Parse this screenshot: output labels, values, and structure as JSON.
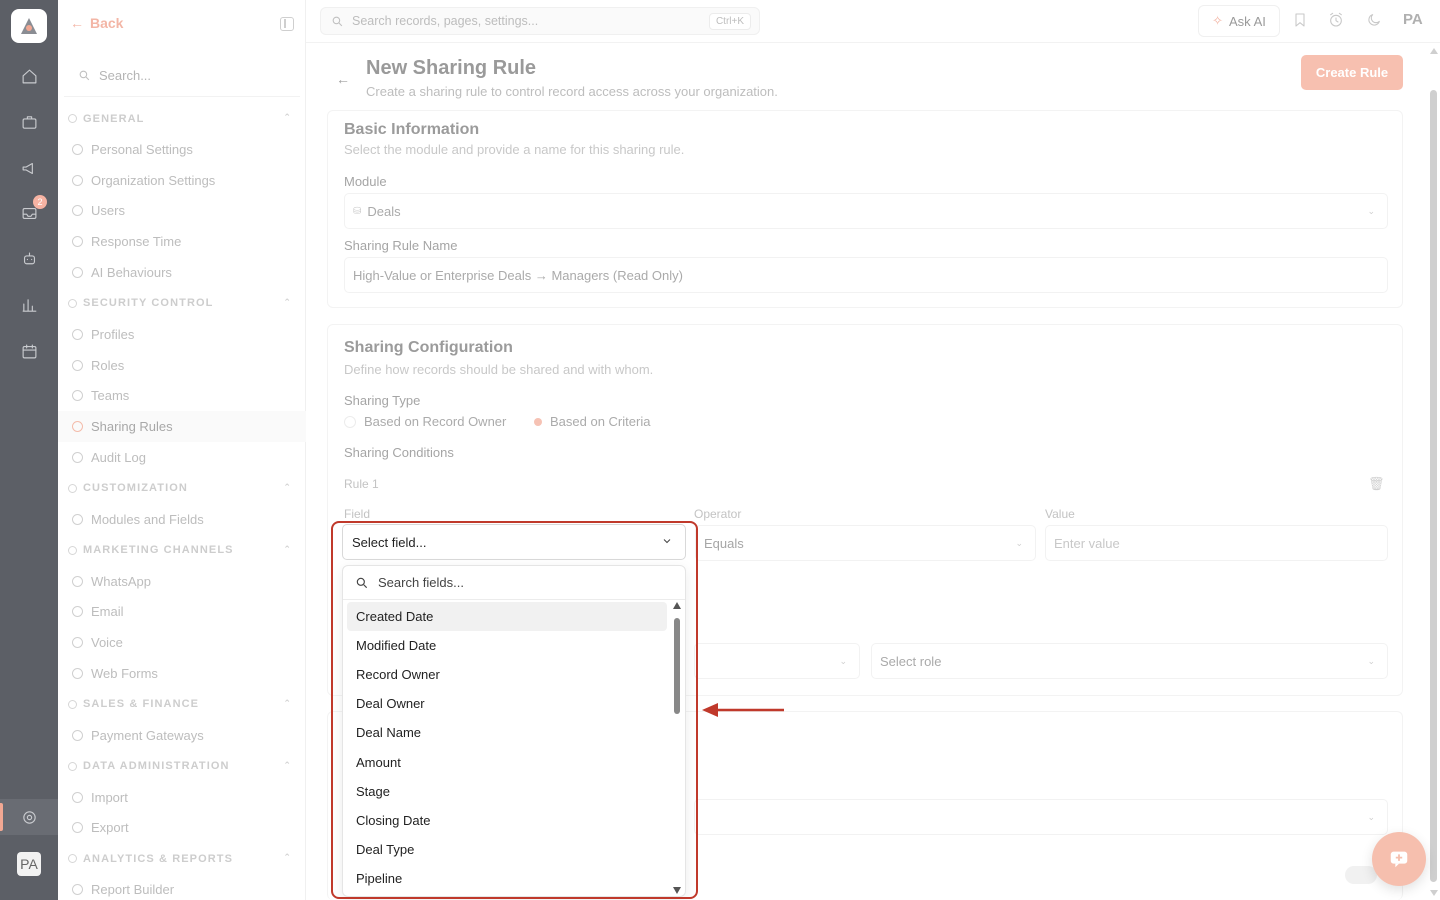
{
  "rail": {
    "badge_count": "2",
    "avatar": "PA",
    "icons": [
      "home-icon",
      "briefcase-icon",
      "megaphone-icon",
      "inbox-icon",
      "robot-icon",
      "chart-icon",
      "calendar-icon",
      "settings-icon"
    ]
  },
  "sidebar": {
    "back_label": "Back",
    "search_placeholder": "Search...",
    "groups": [
      {
        "title": "GENERAL",
        "items": [
          "Personal Settings",
          "Organization Settings",
          "Users",
          "Response Time",
          "AI Behaviours"
        ]
      },
      {
        "title": "SECURITY CONTROL",
        "items": [
          "Profiles",
          "Roles",
          "Teams",
          "Sharing Rules",
          "Audit Log"
        ]
      },
      {
        "title": "CUSTOMIZATION",
        "items": [
          "Modules and Fields"
        ]
      },
      {
        "title": "MARKETING CHANNELS",
        "items": [
          "WhatsApp",
          "Email",
          "Voice",
          "Web Forms"
        ]
      },
      {
        "title": "SALES & FINANCE",
        "items": [
          "Payment Gateways"
        ]
      },
      {
        "title": "DATA ADMINISTRATION",
        "items": [
          "Import",
          "Export"
        ]
      },
      {
        "title": "ANALYTICS & REPORTS",
        "items": [
          "Report Builder"
        ]
      }
    ],
    "active_item": "Sharing Rules"
  },
  "topbar": {
    "search_placeholder": "Search records, pages, settings...",
    "shortcut": "Ctrl+K",
    "ask_ai": "Ask AI",
    "avatar": "PA"
  },
  "header": {
    "title": "New Sharing Rule",
    "subtitle": "Create a sharing rule to control record access across your organization.",
    "create_button": "Create Rule"
  },
  "basic": {
    "title": "Basic Information",
    "subtitle": "Select the module and provide a name for this sharing rule.",
    "module_label": "Module",
    "module_value": "Deals",
    "name_label": "Sharing Rule Name",
    "name_value": "High-Value or Enterprise Deals → Managers (Read Only)"
  },
  "config": {
    "title": "Sharing Configuration",
    "subtitle": "Define how records should be shared and with whom.",
    "type_label": "Sharing Type",
    "type_options": [
      "Based on Record Owner",
      "Based on Criteria"
    ],
    "type_selected": "Based on Criteria",
    "conditions_label": "Sharing Conditions",
    "rule_label": "Rule 1",
    "field_label": "Field",
    "operator_label": "Operator",
    "operator_value": "Equals",
    "value_label": "Value",
    "value_placeholder": "Enter value",
    "role_placeholder": "Select role"
  },
  "dropdown": {
    "trigger": "Select field...",
    "search_placeholder": "Search fields...",
    "options": [
      "Created Date",
      "Modified Date",
      "Record Owner",
      "Deal Owner",
      "Deal Name",
      "Amount",
      "Stage",
      "Closing Date",
      "Deal Type",
      "Pipeline"
    ],
    "highlighted": "Created Date"
  },
  "colors": {
    "accent": "#f7c0b0",
    "highlight_outline": "#c0392b"
  }
}
